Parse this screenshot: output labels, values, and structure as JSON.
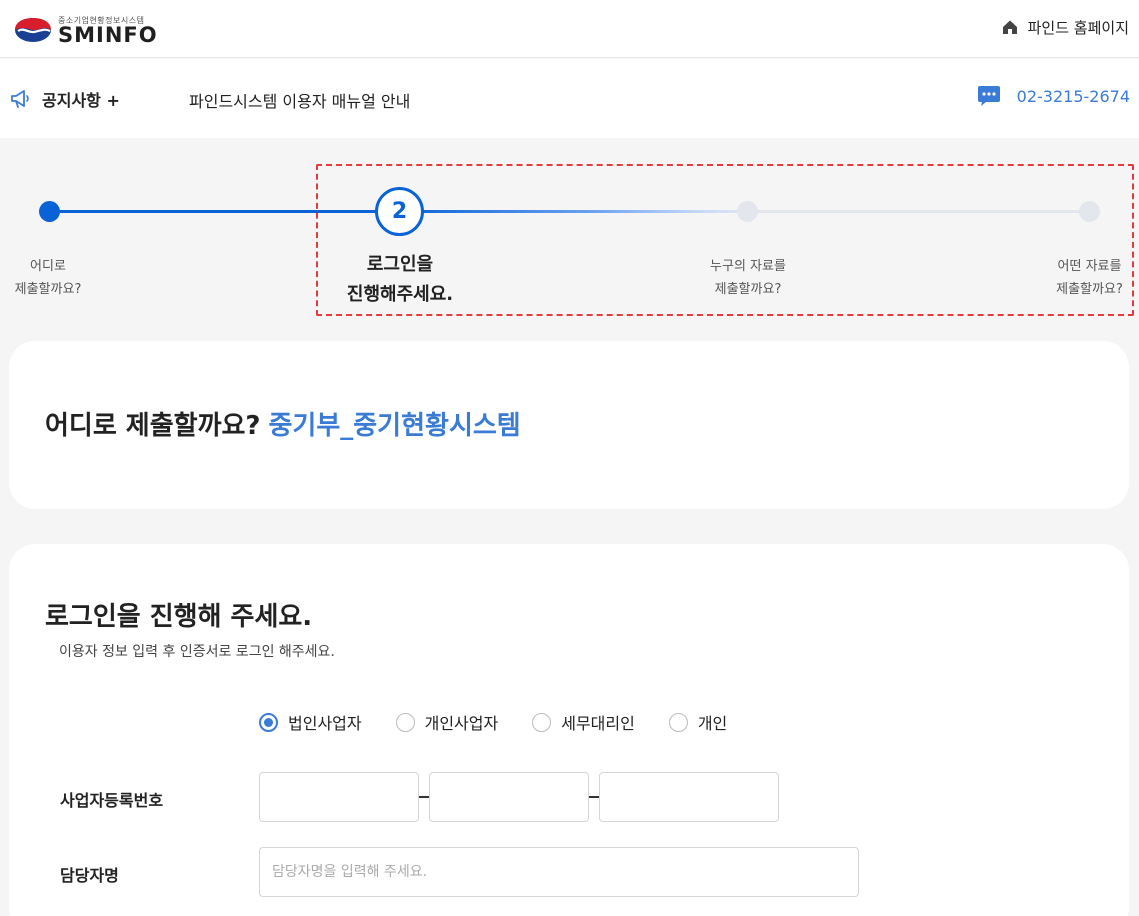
{
  "header": {
    "logo_small": "중소기업현황정보시스템",
    "logo_big": "SMINFO",
    "home_link": "파인드 홈페이지"
  },
  "notice": {
    "label": "공지사항 +",
    "text": "파인드시스템 이용자 매뉴얼 안내",
    "phone": "02-3215-2674"
  },
  "stepper": {
    "current_step": 2,
    "steps": [
      {
        "line1": "어디로",
        "line2": "제출할까요?"
      },
      {
        "line1": "로그인을",
        "line2": "진행해주세요."
      },
      {
        "line1": "누구의 자료를",
        "line2": "제출할까요?"
      },
      {
        "line1": "어떤 자료를",
        "line2": "제출할까요?"
      }
    ],
    "current_number": "2"
  },
  "destination": {
    "question": "어디로 제출할까요?",
    "value": "중기부_중기현황시스템"
  },
  "login": {
    "title": "로그인을 진행해 주세요.",
    "subtitle": "이용자 정보 입력 후 인증서로 로그인 해주세요.",
    "user_types": [
      {
        "label": "법인사업자",
        "selected": true
      },
      {
        "label": "개인사업자",
        "selected": false
      },
      {
        "label": "세무대리인",
        "selected": false
      },
      {
        "label": "개인",
        "selected": false
      }
    ],
    "brn_label": "사업자등록번호",
    "manager_label": "담당자명",
    "manager_placeholder": "담당자명을 입력해 주세요."
  },
  "colors": {
    "accent": "#0a63d6",
    "link": "#3a7bd5",
    "highlight": "#e23b3b"
  }
}
